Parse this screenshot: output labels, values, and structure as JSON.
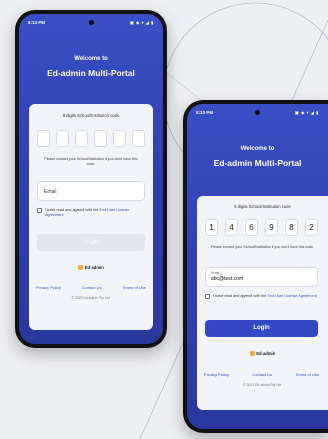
{
  "screen1": {
    "status": {
      "time": "8:13 PM",
      "icons": "▣ ◈ ▾ ◢ ▮"
    },
    "welcome": "Welcome to",
    "title": "Ed-admin Multi-Portal",
    "code_label": "6 digits School/Institution code",
    "code_digits": [
      "",
      "",
      "",
      "",
      "",
      ""
    ],
    "code_note": "Please contact your School/Institution if you don't have this code.",
    "email_placeholder": "Email",
    "agree_text": "I have read and agreed with the",
    "agree_link": "End User License Agreement",
    "login_label": "Login",
    "logo_text": "Ed-admin",
    "links": {
      "privacy": "Privacy Policy",
      "contact": "Contact Us",
      "terms": "Terms of Use"
    },
    "copyright": "© 2023 Ed-admin Pty Ltd."
  },
  "screen2": {
    "status": {
      "time": "8:13 PM",
      "icons": "▣ ◈ ▾ ◢ ▮"
    },
    "welcome": "Welcome to",
    "title": "Ed-admin Multi-Portal",
    "code_label": "6 digits School/Institution code",
    "code_digits": [
      "1",
      "4",
      "6",
      "9",
      "8",
      "2"
    ],
    "code_note": "Please contact your School/Institution if you don't have this code.",
    "email_label": "Email",
    "email_value": "abc@test.com",
    "agree_text": "I have read and agreed with the",
    "agree_link": "End User License Agreement",
    "login_label": "Login",
    "logo_text": "Ed-admin",
    "links": {
      "privacy": "Privacy Policy",
      "contact": "Contact Us",
      "terms": "Terms of Use"
    },
    "copyright": "© 2023 Ed-admin Pty Ltd."
  },
  "colors": {
    "primary": "#3448c2",
    "card": "#f3f4fa",
    "logo": "#f2a93b"
  }
}
